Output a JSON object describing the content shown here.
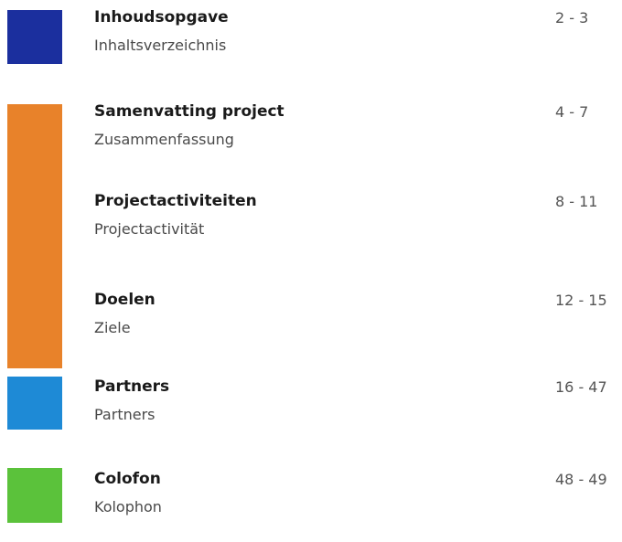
{
  "colors": {
    "blue": "#1b2f9e",
    "orange": "#e8822a",
    "light_blue": "#1e8ad6",
    "green": "#5bc23b"
  },
  "toc": {
    "entries": [
      {
        "title": "Inhoudsopgave",
        "subtitle": "Inhaltsverzeichnis",
        "pages": "2 - 3"
      },
      {
        "title": "Samenvatting project",
        "subtitle": "Zusammenfassung",
        "pages": "4 - 7"
      },
      {
        "title": "Projectactiviteiten",
        "subtitle": "Projectactivität",
        "pages": "8 - 11"
      },
      {
        "title": "Doelen",
        "subtitle": "Ziele",
        "pages": "12 - 15"
      },
      {
        "title": "Partners",
        "subtitle": "Partners",
        "pages": "16 - 47"
      },
      {
        "title": "Colofon",
        "subtitle": "Kolophon",
        "pages": "48 - 49"
      }
    ]
  }
}
